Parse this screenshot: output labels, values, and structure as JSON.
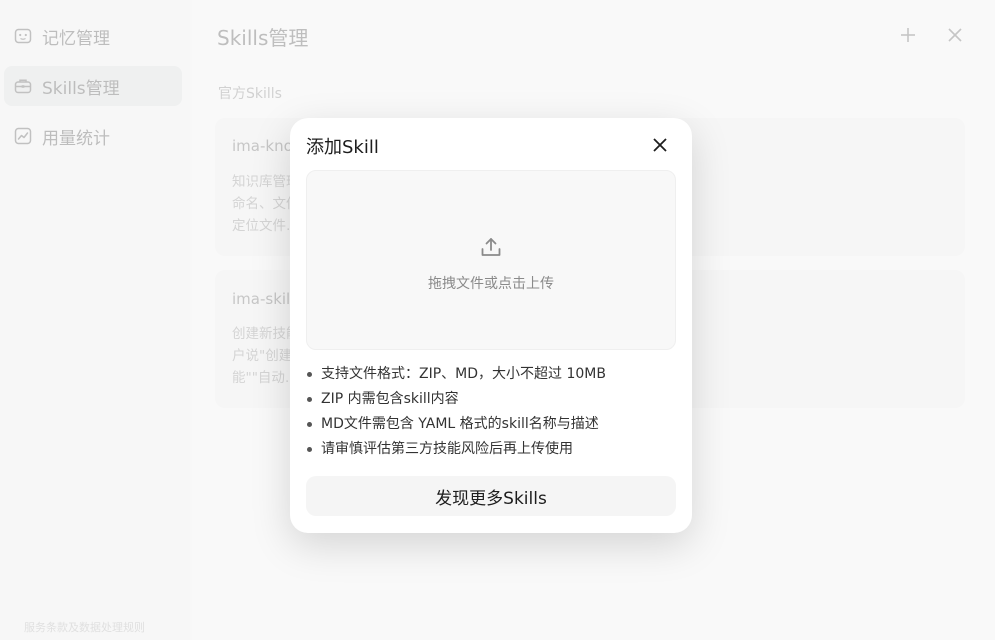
{
  "sidebar": {
    "items": [
      {
        "label": "记忆管理",
        "icon": "memory-icon",
        "active": false
      },
      {
        "label": "Skills管理",
        "icon": "skills-toolbox-icon",
        "active": true
      },
      {
        "label": "用量统计",
        "icon": "usage-chart-icon",
        "active": false
      }
    ],
    "footer": "服务条款及数据处理规则"
  },
  "main": {
    "title": "Skills管理",
    "add_icon": "plus-icon",
    "close_icon": "close-icon",
    "section_label": "官方Skills",
    "cards": [
      {
        "title": "ima-knowledge",
        "lines": [
          "知识库管理，笔记管理…管理用户的笔记和笔记本（新建、追加、推送、重",
          "命名、文件…搜索笔记，按标题定位笔记，按笔记本浏览",
          "定位文件…导出笔记到 workspace，创建/重命…"
        ]
      },
      {
        "title": "ima-skill",
        "lines": [
          "创建新技能…搜索和结构化写作生成研究报告。当用户",
          "户说\"创建…做调研、做行业分析、或者说\"帮我",
          "能\"\"自动…\"、\"帮我写XX论文\"等涉及需要搜集…"
        ]
      }
    ]
  },
  "modal": {
    "title": "添加Skill",
    "close_icon": "close-icon",
    "dropzone_icon": "upload-icon",
    "dropzone_text": "拖拽文件或点击上传",
    "notes": [
      "支持文件格式：ZIP、MD，大小不超过 10MB",
      "ZIP 内需包含skill内容",
      "MD文件需包含 YAML 格式的skill名称与描述",
      "请审慎评估第三方技能风险后再上传使用"
    ],
    "discover_button": "发现更多Skills"
  }
}
